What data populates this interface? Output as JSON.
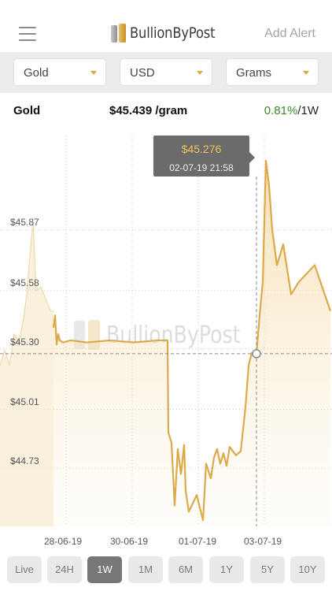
{
  "header": {
    "brand": "BullionByPost",
    "add_alert": "Add Alert",
    "menu_icon": "hamburger-menu-icon"
  },
  "filters": {
    "metal": "Gold",
    "currency": "USD",
    "unit": "Grams"
  },
  "summary": {
    "metal": "Gold",
    "price": "$45.439",
    "price_unit": "/gram",
    "change": "0.81%",
    "change_period": "/1W",
    "change_color": "#3a8a2a"
  },
  "tooltip": {
    "value": "$45.276",
    "time": "02-07-19 21:58"
  },
  "colors": {
    "accent_gold": "#e0a838",
    "line_gold": "#dcaa4a"
  },
  "ranges": {
    "items": [
      "Live",
      "24H",
      "1W",
      "1M",
      "6M",
      "1Y",
      "5Y",
      "10Y"
    ],
    "selected": "1W"
  },
  "chart_data": {
    "type": "area",
    "y_ticks": [
      "$45.87",
      "$45.58",
      "$45.30",
      "$45.01",
      "$44.73"
    ],
    "y_tick_values": [
      45.87,
      45.58,
      45.3,
      45.01,
      44.73
    ],
    "x_ticks": [
      "28-06-19",
      "30-06-19",
      "01-07-19",
      "03-07-19"
    ],
    "ylim": [
      44.45,
      46.35
    ],
    "x": [
      "28-06-19 00:00",
      "28-06-19 02:00",
      "28-06-19 04:00",
      "28-06-19 06:00",
      "28-06-19 08:00",
      "28-06-19 10:00",
      "28-06-19 12:00",
      "28-06-19 14:00",
      "28-06-19 16:00",
      "28-06-19 18:00",
      "28-06-19 20:00",
      "29-06-19 12:00",
      "30-06-19 12:00",
      "30-06-19 22:00",
      "01-07-19 00:00",
      "01-07-19 02:00",
      "01-07-19 04:00",
      "01-07-19 06:00",
      "01-07-19 08:00",
      "01-07-19 10:00",
      "01-07-19 12:00",
      "01-07-19 14:00",
      "01-07-19 16:00",
      "01-07-19 18:00",
      "01-07-19 20:00",
      "01-07-19 22:00",
      "02-07-19 00:00",
      "02-07-19 02:00",
      "02-07-19 04:00",
      "02-07-19 06:00",
      "02-07-19 08:00",
      "02-07-19 10:00",
      "02-07-19 12:00",
      "02-07-19 14:00",
      "02-07-19 16:00",
      "02-07-19 18:00",
      "02-07-19 20:00",
      "02-07-19 21:58",
      "02-07-19 23:00",
      "03-07-19 01:00",
      "03-07-19 03:00",
      "03-07-19 05:00",
      "03-07-19 07:00",
      "03-07-19 09:00",
      "03-07-19 11:00",
      "03-07-19 13:00",
      "03-07-19 15:00",
      "03-07-19 17:00",
      "03-07-19 19:00"
    ],
    "values": [
      45.4,
      45.46,
      45.32,
      45.37,
      45.34,
      45.33,
      45.34,
      45.33,
      45.34,
      45.33,
      45.34,
      45.34,
      45.34,
      45.34,
      44.9,
      44.85,
      44.55,
      44.82,
      44.7,
      44.84,
      44.62,
      44.52,
      44.6,
      44.48,
      44.75,
      44.68,
      44.78,
      44.82,
      44.75,
      44.8,
      44.74,
      44.83,
      44.79,
      44.81,
      45.02,
      45.22,
      45.28,
      45.276,
      45.46,
      45.62,
      46.2,
      46.08,
      45.87,
      45.7,
      45.8,
      45.56,
      45.62,
      45.7,
      45.48
    ],
    "grid": true
  }
}
